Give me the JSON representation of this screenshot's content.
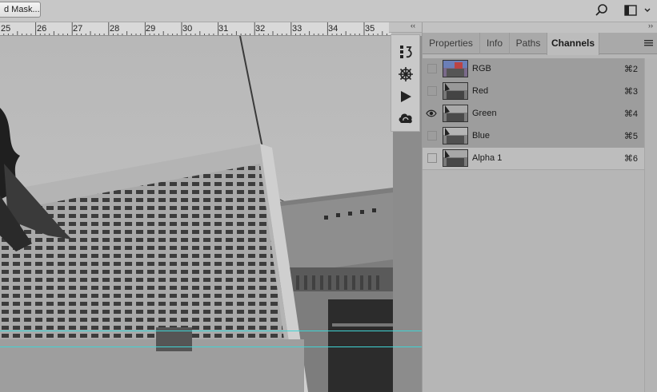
{
  "options_bar": {
    "mask_button_label": "d Mask...",
    "search_icon": "search-icon",
    "workspace_icon": "workspace-switcher-icon"
  },
  "ruler": {
    "labels": [
      "25",
      "26",
      "27",
      "28",
      "29",
      "30",
      "31",
      "32",
      "33",
      "34",
      "35"
    ]
  },
  "dock": {
    "collapse_glyph": "‹‹",
    "icons": [
      "history-icon",
      "navigator-icon",
      "actions-play-icon",
      "libraries-icon"
    ]
  },
  "panel": {
    "collapse_glyph": "››",
    "tabs": [
      {
        "label": "Properties",
        "active": false
      },
      {
        "label": "Info",
        "active": false
      },
      {
        "label": "Paths",
        "active": false
      },
      {
        "label": "Channels",
        "active": true
      }
    ],
    "menu_icon": "panel-menu-icon",
    "channels": [
      {
        "name": "RGB",
        "shortcut": "⌘2",
        "visible": false,
        "thumb": "color"
      },
      {
        "name": "Red",
        "shortcut": "⌘3",
        "visible": false,
        "thumb": "gray"
      },
      {
        "name": "Green",
        "shortcut": "⌘4",
        "visible": true,
        "thumb": "gray"
      },
      {
        "name": "Blue",
        "shortcut": "⌘5",
        "visible": false,
        "thumb": "gray"
      },
      {
        "name": "Alpha 1",
        "shortcut": "⌘6",
        "visible": false,
        "thumb": "gray"
      }
    ]
  },
  "colors": {
    "guide": "#3fd4d4",
    "selected_row": "#9d9d9d",
    "panel_bg": "#b6b6b6"
  }
}
